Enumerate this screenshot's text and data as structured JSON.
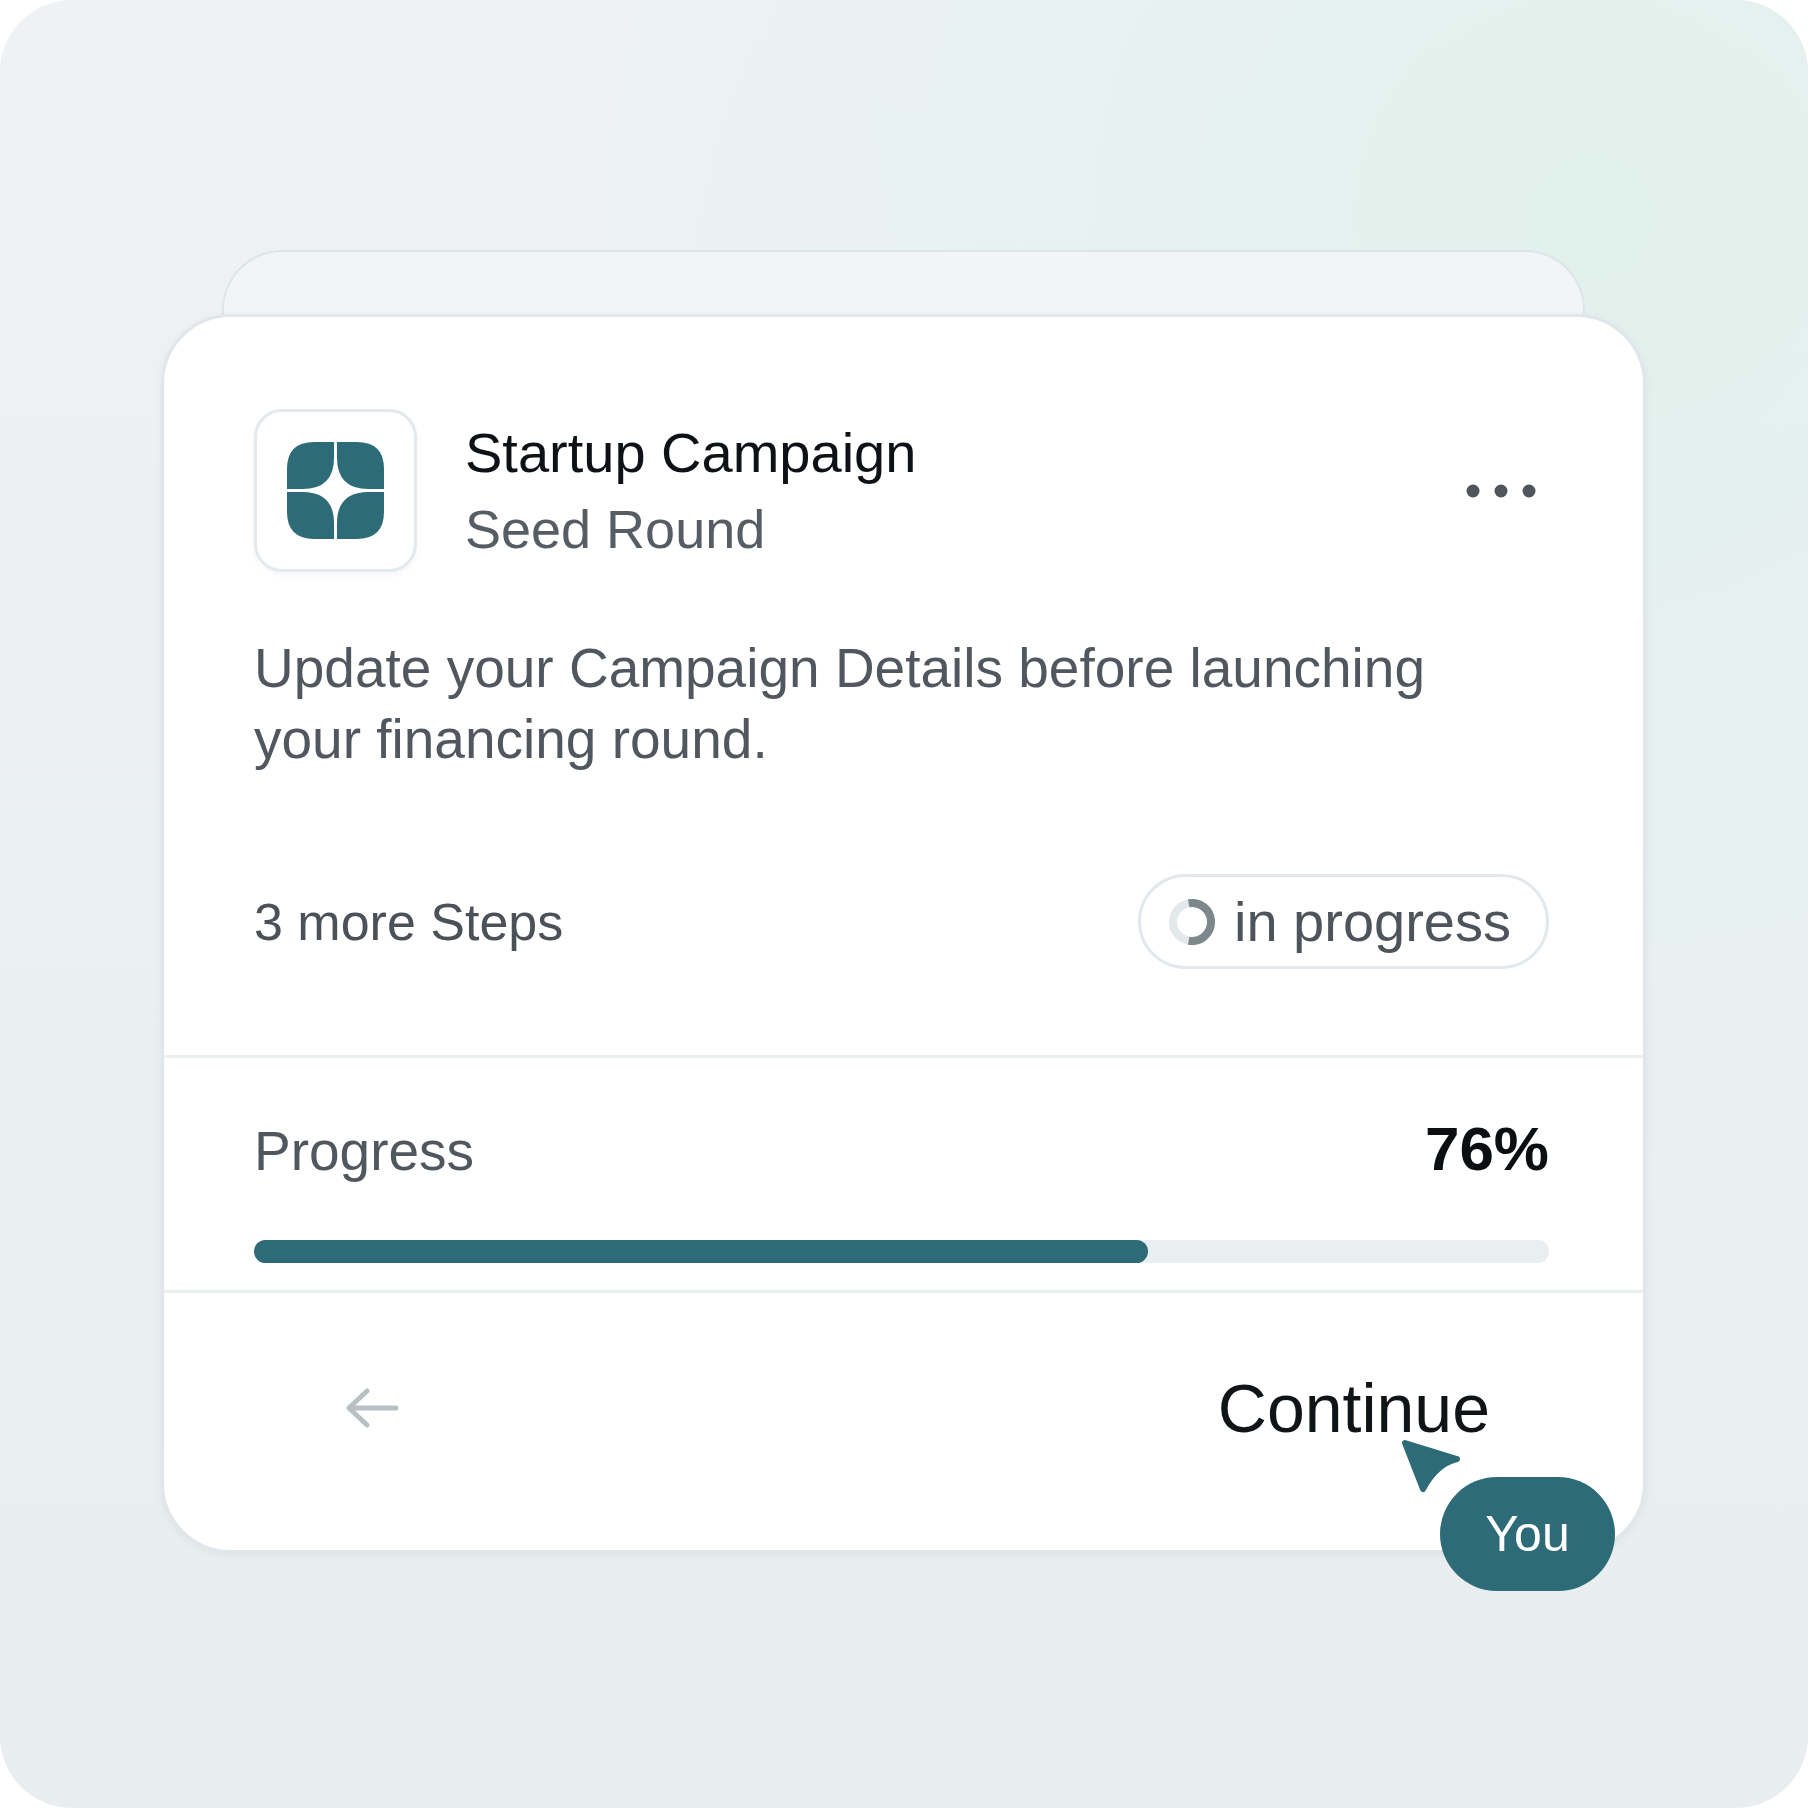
{
  "campaign": {
    "title": "Startup Campaign",
    "subtitle": "Seed Round"
  },
  "description": "Update your Campaign Details before launching your financing round.",
  "steps": {
    "remaining": "3 more Steps",
    "status": "in progress"
  },
  "progress": {
    "label": "Progress",
    "percent": "76%",
    "level": 0.69
  },
  "footer": {
    "action": "Continue"
  },
  "cursor": {
    "label": "You"
  }
}
